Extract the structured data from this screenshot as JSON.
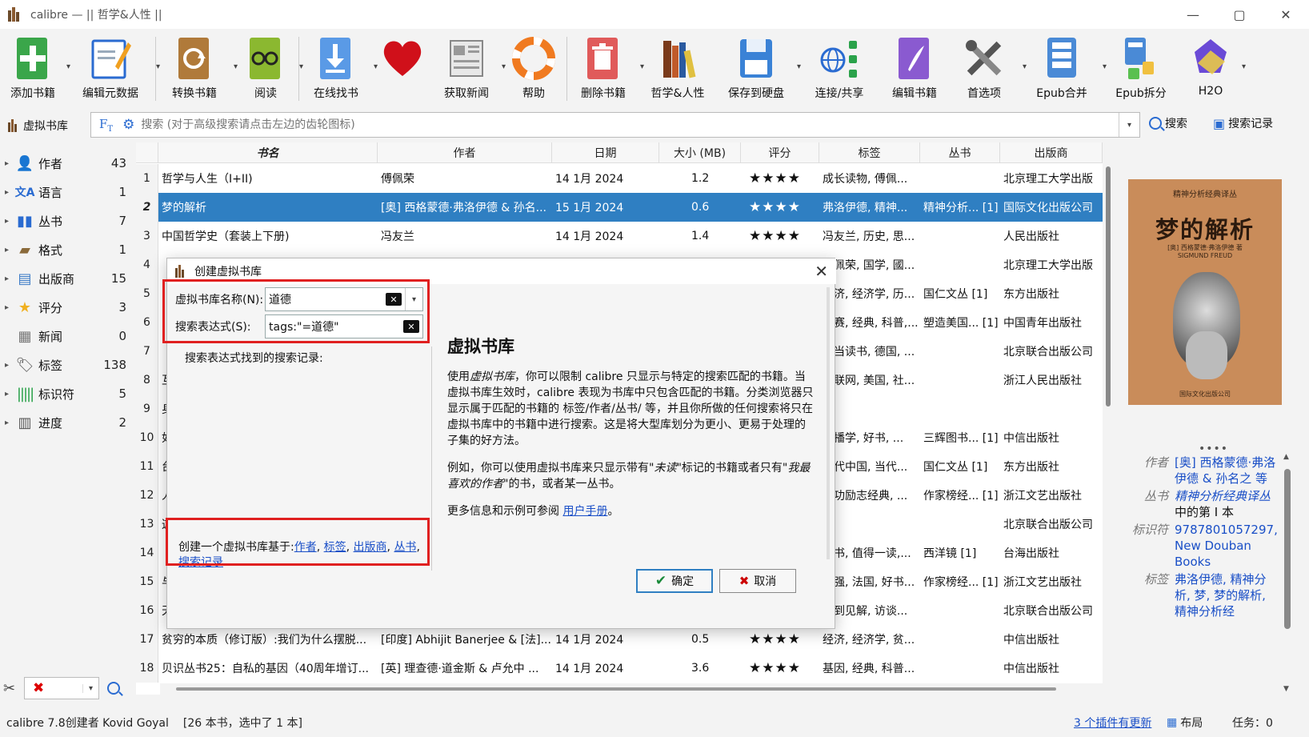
{
  "window": {
    "title": "calibre — || 哲学&人性 ||",
    "controls": [
      "—",
      "▢",
      "✕"
    ]
  },
  "toolbar": [
    {
      "label": "添加书籍",
      "icon": "add-book-icon",
      "menu": true
    },
    {
      "label": "编辑元数据",
      "icon": "edit-metadata-icon",
      "menu": true
    },
    {
      "label": "转换书籍",
      "icon": "convert-book-icon",
      "menu": true
    },
    {
      "label": "阅读",
      "icon": "read-icon",
      "menu": true
    },
    {
      "label": "在线找书",
      "icon": "online-find-icon",
      "menu": true
    },
    {
      "label": "",
      "icon": "heart-icon",
      "menu": false
    },
    {
      "label": "获取新闻",
      "icon": "news-icon",
      "menu": true
    },
    {
      "label": "帮助",
      "icon": "help-icon",
      "menu": false
    },
    {
      "label": "删除书籍",
      "icon": "delete-book-icon",
      "menu": true
    },
    {
      "label": "哲学&人性",
      "icon": "library-icon",
      "menu": false
    },
    {
      "label": "保存到硬盘",
      "icon": "save-disk-icon",
      "menu": true
    },
    {
      "label": "连接/共享",
      "icon": "connect-share-icon",
      "menu": false
    },
    {
      "label": "编辑书籍",
      "icon": "edit-book-icon",
      "menu": false
    },
    {
      "label": "首选项",
      "icon": "preferences-icon",
      "menu": true
    },
    {
      "label": "Epub合并",
      "icon": "epub-merge-icon",
      "menu": true
    },
    {
      "label": "Epub拆分",
      "icon": "epub-split-icon",
      "menu": false
    },
    {
      "label": "H2O",
      "icon": "h2o-icon",
      "menu": true
    }
  ],
  "search": {
    "vlib_label": "虚拟书库",
    "placeholder": "搜索 (对于高级搜索请点击左边的齿轮图标)",
    "search_button": "搜索",
    "saved_button": "搜索记录"
  },
  "tag_browser": [
    {
      "label": "作者",
      "count": "43",
      "icon": "author-icon"
    },
    {
      "label": "语言",
      "count": "1",
      "icon": "language-icon"
    },
    {
      "label": "丛书",
      "count": "7",
      "icon": "series-icon"
    },
    {
      "label": "格式",
      "count": "1",
      "icon": "format-icon"
    },
    {
      "label": "出版商",
      "count": "15",
      "icon": "publisher-icon"
    },
    {
      "label": "评分",
      "count": "3",
      "icon": "rating-icon"
    },
    {
      "label": "新闻",
      "count": "0",
      "icon": "news-icon"
    },
    {
      "label": "标签",
      "count": "138",
      "icon": "tag-icon"
    },
    {
      "label": "标识符",
      "count": "5",
      "icon": "identifier-icon"
    },
    {
      "label": "进度",
      "count": "2",
      "icon": "progress-icon"
    }
  ],
  "book_list": {
    "columns": [
      "书名",
      "作者",
      "日期",
      "大小 (MB)",
      "评分",
      "标签",
      "丛书",
      "出版商"
    ],
    "rows": [
      {
        "num": "1",
        "title": "哲学与人生（I+II)",
        "author": "傅佩荣",
        "date": "14 1月 2024",
        "size": "1.2",
        "rating": "★★★★",
        "tags": "成长读物, 傅佩...",
        "series": "",
        "publisher": "北京理工大学出版"
      },
      {
        "num": "2",
        "title": "梦的解析",
        "author": "[奥] 西格蒙德·弗洛伊德 & 孙名...",
        "date": "15 1月 2024",
        "size": "0.6",
        "rating": "★★★★",
        "tags": "弗洛伊德, 精神...",
        "series": "精神分析... [1]",
        "publisher": "国际文化出版公司"
      },
      {
        "num": "3",
        "title": "中国哲学史（套装上下册)",
        "author": "冯友兰",
        "date": "14 1月 2024",
        "size": "1.4",
        "rating": "★★★★",
        "tags": "冯友兰, 历史, 思...",
        "series": "",
        "publisher": "人民出版社"
      },
      {
        "num": "4",
        "title": "",
        "author": "",
        "date": "",
        "size": "",
        "rating": "",
        "tags": "傅佩荣, 国学, 國...",
        "series": "",
        "publisher": "北京理工大学出版"
      },
      {
        "num": "5",
        "title": "",
        "author": "",
        "date": "",
        "size": "",
        "rating": "",
        "tags": "经济, 经济学, 历...",
        "series": "国仁文丛 [1]",
        "publisher": "东方出版社"
      },
      {
        "num": "6",
        "title": "",
        "author": "",
        "date": "",
        "size": "",
        "rating": "",
        "tags": "金赛, 经典, 科普,...",
        "series": "塑造美国... [1]",
        "publisher": "中国青年出版社"
      },
      {
        "num": "7",
        "title": "",
        "author": "",
        "date": "",
        "size": "",
        "rating": "",
        "tags": "当当读书, 德国, ...",
        "series": "",
        "publisher": "北京联合出版公司"
      },
      {
        "num": "8",
        "title": "互",
        "author": "",
        "date": "",
        "size": "",
        "rating": "",
        "tags": "互联网, 美国, 社...",
        "series": "",
        "publisher": "浙江人民出版社"
      },
      {
        "num": "9",
        "title": "身",
        "author": "",
        "date": "",
        "size": "",
        "rating": "",
        "tags": "",
        "series": "",
        "publisher": ""
      },
      {
        "num": "10",
        "title": "如",
        "author": "",
        "date": "",
        "size": "",
        "rating": "",
        "tags": "传播学, 好书, ...",
        "series": "三辉图书... [1]",
        "publisher": "中信出版社"
      },
      {
        "num": "11",
        "title": "台",
        "author": "",
        "date": "",
        "size": "",
        "rating": "",
        "tags": "当代中国, 当代...",
        "series": "国仁文丛 [1]",
        "publisher": "东方出版社"
      },
      {
        "num": "12",
        "title": "人",
        "author": "",
        "date": "",
        "size": "",
        "rating": "",
        "tags": "成功励志经典, ...",
        "series": "作家榜经... [1]",
        "publisher": "浙江文艺出版社"
      },
      {
        "num": "13",
        "title": "这",
        "author": "",
        "date": "",
        "size": "",
        "rating": "★",
        "tags": "",
        "series": "",
        "publisher": "北京联合出版公司"
      },
      {
        "num": "14",
        "title": "",
        "author": "",
        "date": "",
        "size": "",
        "rating": "",
        "tags": "好书, 值得一读,...",
        "series": "西洋镜 [1]",
        "publisher": "台海出版社"
      },
      {
        "num": "15",
        "title": "与",
        "author": "",
        "date": "",
        "size": "",
        "rating": "",
        "tags": "董强, 法国, 好书...",
        "series": "作家榜经... [1]",
        "publisher": "浙江文艺出版社"
      },
      {
        "num": "16",
        "title": "天才在左，疯子在右",
        "author": "高铭",
        "date": "14 1月 2024",
        "size": "0.7",
        "rating": "★★★★",
        "tags": "独到见解, 访谈...",
        "series": "",
        "publisher": "北京联合出版公司"
      },
      {
        "num": "17",
        "title": "贫穷的本质（修订版）:我们为什么摆脱...",
        "author": "[印度] Abhijit Banerjee & [法]...",
        "date": "14 1月 2024",
        "size": "0.5",
        "rating": "★★★★",
        "tags": "经济, 经济学, 贫...",
        "series": "",
        "publisher": "中信出版社"
      },
      {
        "num": "18",
        "title": "贝识丛书25：自私的基因（40周年增订...",
        "author": "[英] 理查德·道金斯 & 卢允中 ...",
        "date": "14 1月 2024",
        "size": "3.6",
        "rating": "★★★★",
        "tags": "基因, 经典, 科普...",
        "series": "",
        "publisher": "中信出版社"
      }
    ]
  },
  "cover": {
    "top_text": "精神分析经典译丛",
    "title": "梦的解析",
    "author_line": "[奥] 西格蒙德·弗洛伊德 著",
    "author_en": "SIGMUND FREUD",
    "publisher": "国际文化出版公司"
  },
  "details": [
    {
      "key": "作者",
      "value": "[奥] 西格蒙德·弗洛伊德 & 孙名之 等"
    },
    {
      "key": "丛书",
      "value": "精神分析经典译丛",
      "suffix": " 中的第 I 本"
    },
    {
      "key": "标识符",
      "value": "9787801057297, New Douban Books"
    },
    {
      "key": "标签",
      "value": "弗洛伊德, 精神分析, 梦, 梦的解析, 精神分析经"
    }
  ],
  "status": {
    "version": "calibre 7.8创建者 Kovid Goyal",
    "count": "[26 本书，选中了 1 本]",
    "updates": "3 个插件有更新",
    "layout": "布局",
    "jobs": "任务：0"
  },
  "dialog": {
    "title": "创建虚拟书库",
    "name_label": "虚拟书库名称(N):",
    "name_value": "道德",
    "expr_label": "搜索表达式(S):",
    "expr_value": "tags:\"=道德\"",
    "saved_header": "搜索表达式找到的搜索记录:",
    "help_title": "虚拟书库",
    "help_p1_a": "使用",
    "help_p1_em": "虚拟书库",
    "help_p1_b": "，你可以限制 calibre 只显示与特定的搜索匹配的书籍。当虚拟书库生效时，calibre 表现为书库中只包含匹配的书籍。分类浏览器只显示属于匹配的书籍的 标签/作者/丛书/ 等，并且你所做的任何搜索将只在虚拟书库中的书籍中进行搜索。这是将大型库划分为更小、更易于处理的子集的好方法。",
    "help_p2_a": "例如，你可以使用虚拟书库来只显示带有",
    "help_p2_em1": "\"未读\"",
    "help_p2_b": "标记的书籍或者只有",
    "help_p2_em2": "\"我最喜欢的作者\"",
    "help_p2_c": "的书，或者某一丛书。",
    "help_p3": "更多信息和示例可参阅 ",
    "help_p3_link": "用户手册",
    "help_p3_end": "。",
    "create_prefix": "创建一个虚拟书库基于:",
    "create_links": [
      "作者",
      "标签",
      "出版商",
      "丛书",
      "搜索记录"
    ],
    "ok": "确定",
    "cancel": "取消"
  },
  "colors": {
    "selection": "#2f7fc2",
    "highlight_box": "#e02020",
    "link": "#1a4fc7"
  }
}
